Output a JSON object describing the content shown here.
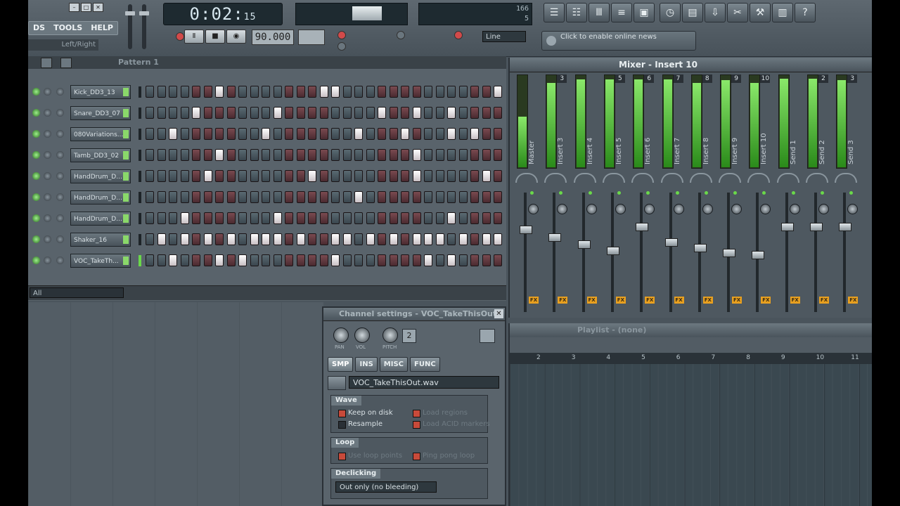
{
  "menu": [
    "TOOLS",
    "HELP"
  ],
  "menu_partial": "DS",
  "hint": "Left/Right",
  "window_buttons": [
    "–",
    "□",
    "✕"
  ],
  "time": {
    "main": "0:02:",
    "sub": "15"
  },
  "transport": {
    "pause": "Ⅱ",
    "stop": "■",
    "record": "◉"
  },
  "tempo": "90.000",
  "cpu": {
    "v1": "166",
    "v2": "5"
  },
  "snap": "Line",
  "news": "Click to enable online news",
  "toolbar_icons": [
    "list-icon",
    "piano-icon",
    "channel-icon",
    "mixer-icon",
    "plugin-icon",
    "clock-icon",
    "save-icon",
    "export-icon",
    "cut-icon",
    "wrench-icon",
    "disk-icon",
    "help-icon"
  ],
  "toolbar_glyphs": [
    "☰",
    "☷",
    "Ⅲ",
    "≡",
    "▣",
    "◷",
    "▤",
    "⇩",
    "✂",
    "⚒",
    "▥",
    "?"
  ],
  "pattern": {
    "title": "Pattern 1"
  },
  "channels": [
    {
      "name": "Kick_DD3_13",
      "steps": [
        0,
        0,
        0,
        0,
        0,
        0,
        1,
        0,
        0,
        0,
        0,
        0,
        0,
        0,
        0,
        1,
        1,
        0,
        0,
        0,
        0,
        0,
        0,
        0,
        0,
        0,
        0,
        0,
        0,
        0,
        1
      ]
    },
    {
      "name": "Snare_DD3_07",
      "steps": [
        0,
        0,
        0,
        0,
        1,
        0,
        0,
        0,
        0,
        0,
        0,
        1,
        0,
        0,
        0,
        0,
        0,
        0,
        0,
        0,
        1,
        0,
        0,
        1,
        0,
        0,
        1,
        0,
        0,
        0,
        0
      ]
    },
    {
      "name": "080Variations...",
      "steps": [
        0,
        0,
        1,
        0,
        0,
        0,
        0,
        0,
        0,
        0,
        1,
        0,
        0,
        0,
        0,
        0,
        0,
        0,
        1,
        0,
        0,
        0,
        1,
        0,
        0,
        0,
        1,
        0,
        1,
        0,
        0
      ]
    },
    {
      "name": "Tamb_DD3_02",
      "steps": [
        0,
        0,
        0,
        0,
        0,
        0,
        1,
        0,
        0,
        0,
        0,
        0,
        0,
        0,
        0,
        0,
        0,
        0,
        0,
        0,
        0,
        0,
        0,
        1,
        0,
        0,
        0,
        0,
        0,
        0,
        0
      ]
    },
    {
      "name": "HandDrum_D...",
      "steps": [
        0,
        0,
        0,
        0,
        0,
        1,
        0,
        0,
        0,
        0,
        0,
        0,
        0,
        0,
        1,
        0,
        0,
        0,
        0,
        0,
        0,
        0,
        0,
        1,
        0,
        0,
        0,
        0,
        0,
        1,
        0
      ]
    },
    {
      "name": "HandDrum_D...",
      "steps": [
        0,
        0,
        0,
        0,
        0,
        0,
        0,
        0,
        0,
        0,
        0,
        0,
        0,
        0,
        0,
        0,
        0,
        0,
        1,
        0,
        0,
        0,
        0,
        0,
        0,
        0,
        0,
        0,
        0,
        0,
        0
      ]
    },
    {
      "name": "HandDrum_D...",
      "steps": [
        0,
        0,
        0,
        1,
        0,
        0,
        0,
        0,
        0,
        0,
        0,
        1,
        0,
        0,
        0,
        0,
        0,
        0,
        0,
        0,
        0,
        0,
        0,
        0,
        0,
        0,
        1,
        0,
        0,
        0,
        0
      ]
    },
    {
      "name": "Shaker_16",
      "steps": [
        0,
        1,
        0,
        1,
        0,
        1,
        0,
        1,
        0,
        1,
        1,
        1,
        0,
        1,
        0,
        0,
        1,
        1,
        0,
        1,
        0,
        1,
        0,
        1,
        1,
        1,
        0,
        1,
        0,
        1,
        1
      ]
    },
    {
      "name": "VOC_TakeTh...",
      "steps": [
        0,
        0,
        1,
        0,
        0,
        0,
        1,
        0,
        1,
        0,
        0,
        0,
        0,
        0,
        0,
        0,
        1,
        0,
        0,
        0,
        0,
        0,
        0,
        0,
        1,
        0,
        1,
        0,
        0,
        0,
        0
      ]
    }
  ],
  "filter": "All",
  "mixer": {
    "title": "Mixer - Insert 10",
    "strips": [
      {
        "label": "Master",
        "num": "",
        "level": 0.55
      },
      {
        "label": "Insert 3",
        "num": "3",
        "level": 0.92
      },
      {
        "label": "Insert 4",
        "num": "",
        "level": 0.96
      },
      {
        "label": "Insert 5",
        "num": "5",
        "level": 0.96
      },
      {
        "label": "Insert 6",
        "num": "6",
        "level": 0.96
      },
      {
        "label": "Insert 7",
        "num": "7",
        "level": 0.96
      },
      {
        "label": "Insert 8",
        "num": "8",
        "level": 0.92
      },
      {
        "label": "Insert 9",
        "num": "9",
        "level": 0.95
      },
      {
        "label": "Insert 10",
        "num": "10",
        "level": 0.92
      },
      {
        "label": "Send 1",
        "num": "",
        "level": 0.97
      },
      {
        "label": "Send 2",
        "num": "2",
        "level": 0.97
      },
      {
        "label": "Send 3",
        "num": "3",
        "level": 0.95
      }
    ],
    "fader_levels": [
      0.82,
      0.75,
      0.68,
      0.62,
      0.85,
      0.7,
      0.65,
      0.6,
      0.58,
      0.85,
      0.85,
      0.85
    ]
  },
  "channel_settings": {
    "title": "Channel settings - VOC_TakeThisOut",
    "knobs": [
      "PAN",
      "VOL",
      "PITCH"
    ],
    "number": "2",
    "tabs": [
      "SMP",
      "INS",
      "MISC",
      "FUNC"
    ],
    "sample": "VOC_TakeThisOut.wav",
    "wave": {
      "label": "Wave",
      "keep": "Keep on disk",
      "resample": "Resample",
      "load_regions": "Load regions",
      "load_acid": "Load ACID markers"
    },
    "loop": {
      "label": "Loop",
      "use_loop": "Use loop points",
      "ping_pong": "Ping pong loop"
    },
    "declicking": {
      "label": "Declicking",
      "mode": "Out only (no bleeding)"
    }
  },
  "playlist": {
    "title": "Playlist - (none)",
    "ruler": [
      "2",
      "3",
      "4",
      "5",
      "6",
      "7",
      "8",
      "9",
      "10",
      "11"
    ]
  },
  "colors": {
    "accent": "#e8a020",
    "meter": "#6ad84a",
    "step_on": "#ffffff"
  }
}
